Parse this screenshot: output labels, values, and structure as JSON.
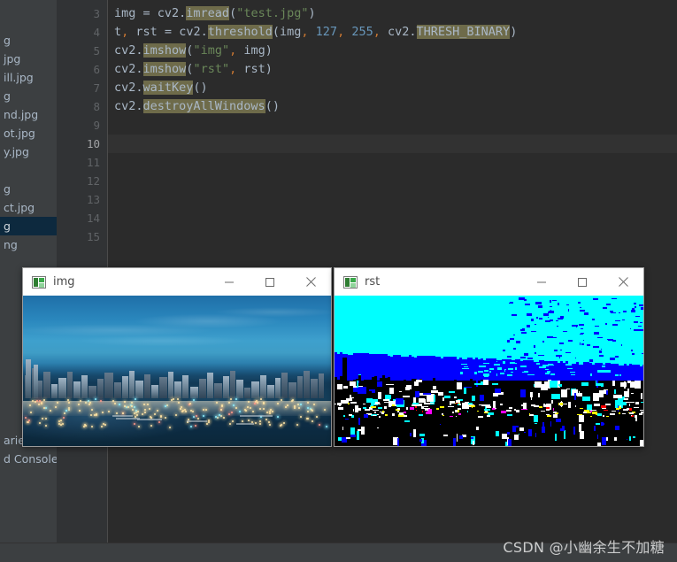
{
  "editor": {
    "first_visible_line": 3,
    "current_line": 10,
    "line_numbers": [
      3,
      4,
      5,
      6,
      7,
      8,
      9,
      10,
      11,
      12,
      13,
      14,
      15
    ],
    "code_lines": [
      {
        "number": 3,
        "text": "img = cv2.imread(\"test.jpg\")",
        "tokens": [
          {
            "t": "img",
            "k": "id"
          },
          {
            "t": " = ",
            "k": "punc"
          },
          {
            "t": "cv2.",
            "k": "id"
          },
          {
            "t": "imread",
            "k": "fn"
          },
          {
            "t": "(",
            "k": "punc"
          },
          {
            "t": "\"test.jpg\"",
            "k": "str"
          },
          {
            "t": ")",
            "k": "punc"
          }
        ]
      },
      {
        "number": 4,
        "text": "t, rst = cv2.threshold(img, 127, 255, cv2.THRESH_BINARY)",
        "tokens": [
          {
            "t": "t",
            "k": "id"
          },
          {
            "t": ",",
            "k": "comma"
          },
          {
            "t": " rst = ",
            "k": "punc"
          },
          {
            "t": "cv2.",
            "k": "id"
          },
          {
            "t": "threshold",
            "k": "fn"
          },
          {
            "t": "(",
            "k": "punc"
          },
          {
            "t": "img",
            "k": "id"
          },
          {
            "t": ",",
            "k": "comma"
          },
          {
            "t": " ",
            "k": "punc"
          },
          {
            "t": "127",
            "k": "num"
          },
          {
            "t": ",",
            "k": "comma"
          },
          {
            "t": " ",
            "k": "punc"
          },
          {
            "t": "255",
            "k": "num"
          },
          {
            "t": ",",
            "k": "comma"
          },
          {
            "t": " cv2.",
            "k": "id"
          },
          {
            "t": "THRESH_BINARY",
            "k": "const"
          },
          {
            "t": ")",
            "k": "punc"
          }
        ]
      },
      {
        "number": 5,
        "text": "cv2.imshow(\"img\", img)",
        "tokens": [
          {
            "t": "cv2.",
            "k": "id"
          },
          {
            "t": "imshow",
            "k": "fn"
          },
          {
            "t": "(",
            "k": "punc"
          },
          {
            "t": "\"img\"",
            "k": "str"
          },
          {
            "t": ",",
            "k": "comma"
          },
          {
            "t": " img",
            "k": "id"
          },
          {
            "t": ")",
            "k": "punc"
          }
        ]
      },
      {
        "number": 6,
        "text": "cv2.imshow(\"rst\", rst)",
        "tokens": [
          {
            "t": "cv2.",
            "k": "id"
          },
          {
            "t": "imshow",
            "k": "fn"
          },
          {
            "t": "(",
            "k": "punc"
          },
          {
            "t": "\"rst\"",
            "k": "str"
          },
          {
            "t": ",",
            "k": "comma"
          },
          {
            "t": " rst",
            "k": "id"
          },
          {
            "t": ")",
            "k": "punc"
          }
        ]
      },
      {
        "number": 7,
        "text": "cv2.waitKey()",
        "tokens": [
          {
            "t": "cv2.",
            "k": "id"
          },
          {
            "t": "waitKey",
            "k": "fn"
          },
          {
            "t": "()",
            "k": "punc"
          }
        ]
      },
      {
        "number": 8,
        "text": "cv2.destroyAllWindows()",
        "tokens": [
          {
            "t": "cv2.",
            "k": "id"
          },
          {
            "t": "destroyAllWindows",
            "k": "fn"
          },
          {
            "t": "()",
            "k": "punc"
          }
        ]
      }
    ]
  },
  "sidebar": {
    "items": [
      {
        "label": "g",
        "selected": false
      },
      {
        "label": "jpg",
        "selected": false
      },
      {
        "label": "ill.jpg",
        "selected": false
      },
      {
        "label": "g",
        "selected": false
      },
      {
        "label": "nd.jpg",
        "selected": false
      },
      {
        "label": "ot.jpg",
        "selected": false
      },
      {
        "label": "y.jpg",
        "selected": false
      },
      {
        "label": "",
        "selected": false
      },
      {
        "label": "g",
        "selected": false
      },
      {
        "label": "ct.jpg",
        "selected": false
      },
      {
        "label": "g",
        "selected": true
      },
      {
        "label": "ng",
        "selected": false
      }
    ],
    "bottom_items": [
      {
        "label": "aries"
      },
      {
        "label": "d Consoles"
      }
    ]
  },
  "windows": [
    {
      "id": "img",
      "title": "img",
      "icon": "opencv-window-icon",
      "minimize_label": "—",
      "maximize_label": "□",
      "close_label": "✕",
      "content_kind": "photo",
      "content_description": "Dusk cityscape over harbour with illuminated skyline"
    },
    {
      "id": "rst",
      "title": "rst",
      "icon": "opencv-window-icon",
      "minimize_label": "—",
      "maximize_label": "□",
      "close_label": "✕",
      "content_kind": "threshold",
      "content_description": "Binary threshold result: cyan sky, blue midtones, black shadows"
    }
  ],
  "watermark": {
    "text": "CSDN @小幽余生不加糖"
  },
  "colors": {
    "editor_bg": "#2b2b2b",
    "gutter_bg": "#313335",
    "sidebar_bg": "#3c3f41",
    "selection_bg": "#0d293e",
    "identifier": "#a9b7c6",
    "string": "#6a8759",
    "number": "#6897bb",
    "highlight": "#6e6b4a",
    "comma": "#cc7832",
    "threshold_cyan": "#00ffff",
    "threshold_blue": "#0000ff",
    "threshold_black": "#000000"
  }
}
